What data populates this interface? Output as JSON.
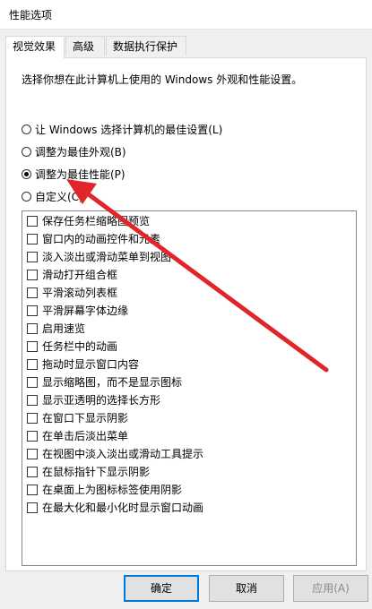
{
  "window": {
    "title": "性能选项"
  },
  "tabs": [
    {
      "label": "视觉效果",
      "active": true
    },
    {
      "label": "高级",
      "active": false
    },
    {
      "label": "数据执行保护",
      "active": false
    }
  ],
  "description": "选择你想在此计算机上使用的 Windows 外观和性能设置。",
  "radios": [
    {
      "label": "让 Windows 选择计算机的最佳设置(L)",
      "checked": false
    },
    {
      "label": "调整为最佳外观(B)",
      "checked": false
    },
    {
      "label": "调整为最佳性能(P)",
      "checked": true
    },
    {
      "label": "自定义(C)",
      "checked": false
    }
  ],
  "checkboxes": [
    {
      "label": "保存任务栏缩略图预览",
      "checked": false
    },
    {
      "label": "窗口内的动画控件和元素",
      "checked": false
    },
    {
      "label": "淡入淡出或滑动菜单到视图",
      "checked": false
    },
    {
      "label": "滑动打开组合框",
      "checked": false
    },
    {
      "label": "平滑滚动列表框",
      "checked": false
    },
    {
      "label": "平滑屏幕字体边缘",
      "checked": false
    },
    {
      "label": "启用速览",
      "checked": false
    },
    {
      "label": "任务栏中的动画",
      "checked": false
    },
    {
      "label": "拖动时显示窗口内容",
      "checked": false
    },
    {
      "label": "显示缩略图，而不是显示图标",
      "checked": false
    },
    {
      "label": "显示亚透明的选择长方形",
      "checked": false
    },
    {
      "label": "在窗口下显示阴影",
      "checked": false
    },
    {
      "label": "在单击后淡出菜单",
      "checked": false
    },
    {
      "label": "在视图中淡入淡出或滑动工具提示",
      "checked": false
    },
    {
      "label": "在鼠标指针下显示阴影",
      "checked": false
    },
    {
      "label": "在桌面上为图标标签使用阴影",
      "checked": false
    },
    {
      "label": "在最大化和最小化时显示窗口动画",
      "checked": false
    }
  ],
  "buttons": {
    "ok": "确定",
    "cancel": "取消",
    "apply": "应用(A)"
  },
  "colors": {
    "annotation_arrow": "#e0262b",
    "default_button_border": "#0078d7"
  }
}
